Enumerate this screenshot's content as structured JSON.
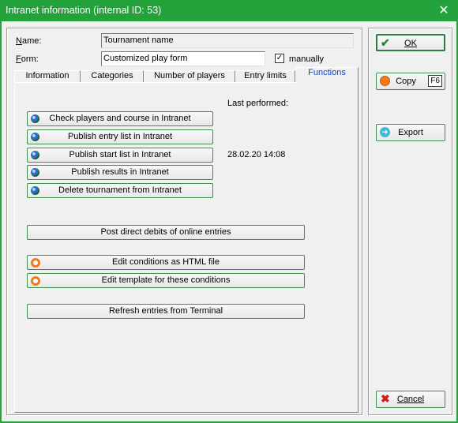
{
  "window": {
    "title": "Intranet information (internal ID: 53)"
  },
  "form": {
    "name_label": "Name:",
    "name_value": "Tournament name",
    "form_label": "Form:",
    "form_value": "Customized play form",
    "manually_label": "manually",
    "manually_checked": true,
    "checkmark": "✓"
  },
  "tabs": [
    {
      "label": "Information"
    },
    {
      "label": "Categories"
    },
    {
      "label": "Number of players"
    },
    {
      "label": "Entry limits"
    },
    {
      "label": "Functions"
    }
  ],
  "functions": {
    "last_performed_label": "Last performed:",
    "publish_start_date": "28.02.20 14:08",
    "intranet_buttons": [
      {
        "label": "Check players and course in Intranet",
        "icon": "globe-icon"
      },
      {
        "label": "Publish entry list in Intranet",
        "icon": "globe-icon"
      },
      {
        "label": "Publish start list in Intranet",
        "icon": "globe-icon"
      },
      {
        "label": "Publish results in Intranet",
        "icon": "globe-icon"
      },
      {
        "label": "Delete tournament from Intranet",
        "icon": "globe-icon"
      }
    ],
    "post_debits_label": "Post direct debits of online entries",
    "edit_conditions_label": "Edit conditions as HTML file",
    "edit_template_label": "Edit template for these conditions",
    "refresh_label": "Refresh entries from Terminal"
  },
  "actions": {
    "ok_label": "OK",
    "copy_label": "Copy",
    "copy_shortcut": "F6",
    "export_label": "Export",
    "cancel_label": "Cancel"
  },
  "colors": {
    "titlebar": "#23a23b",
    "active_tab": "#1a3fd8",
    "ok_check": "#1f8a2e",
    "cancel_x": "#d42020"
  }
}
